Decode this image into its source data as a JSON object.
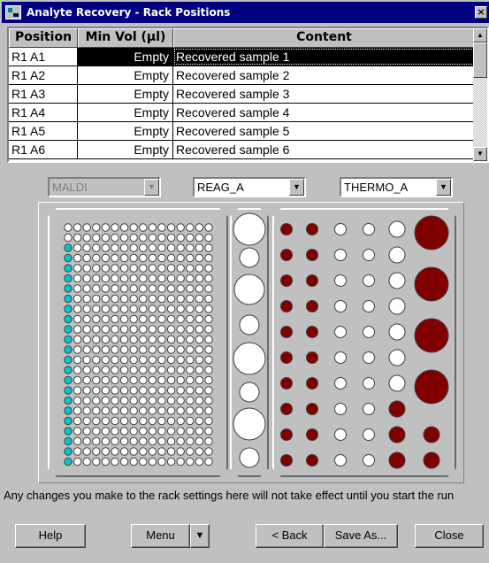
{
  "window": {
    "title": "Analyte Recovery - Rack Positions",
    "close_label": "×"
  },
  "table": {
    "columns": [
      "Position",
      "Min Vol (µl)",
      "Content"
    ],
    "rows": [
      {
        "position": "R1  A1",
        "min_vol": "Empty",
        "content": "Recovered sample 1",
        "selected": true
      },
      {
        "position": "R1  A2",
        "min_vol": "Empty",
        "content": "Recovered sample 2"
      },
      {
        "position": "R1  A3",
        "min_vol": "Empty",
        "content": "Recovered sample 3"
      },
      {
        "position": "R1  A4",
        "min_vol": "Empty",
        "content": "Recovered sample 4"
      },
      {
        "position": "R1  A5",
        "min_vol": "Empty",
        "content": "Recovered sample 5"
      },
      {
        "position": "R1  A6",
        "min_vol": "Empty",
        "content": "Recovered sample 6"
      }
    ]
  },
  "dropdowns": {
    "left": {
      "value": "MALDI",
      "disabled": true
    },
    "middle": {
      "value": "REAG_A",
      "disabled": false
    },
    "right": {
      "value": "THERMO_A",
      "disabled": false
    }
  },
  "rack": {
    "colors": {
      "well_filled": "#00c8c8",
      "reagent_filled": "#800000",
      "empty": "#ffffff"
    },
    "maldi_plate": {
      "rows": 24,
      "cols": 16,
      "filled_col": 0,
      "filled_rows_from": 2
    },
    "thermo_rows": [
      [
        "filled",
        "filled",
        "empty",
        "empty",
        "empty",
        "filled-large"
      ],
      [
        "filled",
        "filled",
        "empty",
        "empty",
        "empty",
        ""
      ],
      [
        "filled",
        "filled",
        "empty",
        "empty",
        "empty",
        "filled-large"
      ],
      [
        "filled",
        "filled",
        "empty",
        "empty",
        "empty",
        ""
      ],
      [
        "filled",
        "filled",
        "empty",
        "empty",
        "empty",
        "filled-large"
      ],
      [
        "filled",
        "filled",
        "empty",
        "empty",
        "empty",
        ""
      ],
      [
        "filled",
        "filled",
        "empty",
        "empty",
        "empty",
        "filled-large"
      ],
      [
        "filled",
        "filled",
        "empty",
        "empty",
        "filled",
        ""
      ],
      [
        "filled",
        "filled",
        "empty",
        "empty",
        "filled",
        "filled"
      ],
      [
        "filled",
        "filled",
        "empty",
        "empty",
        "filled",
        "filled"
      ]
    ]
  },
  "notice": "Any changes you make to the rack settings here will not take effect until you start the run",
  "buttons": {
    "help": "Help",
    "menu": "Menu",
    "menu_arrow": "▼",
    "back": "< Back",
    "save_as": "Save As...",
    "close": "Close"
  }
}
